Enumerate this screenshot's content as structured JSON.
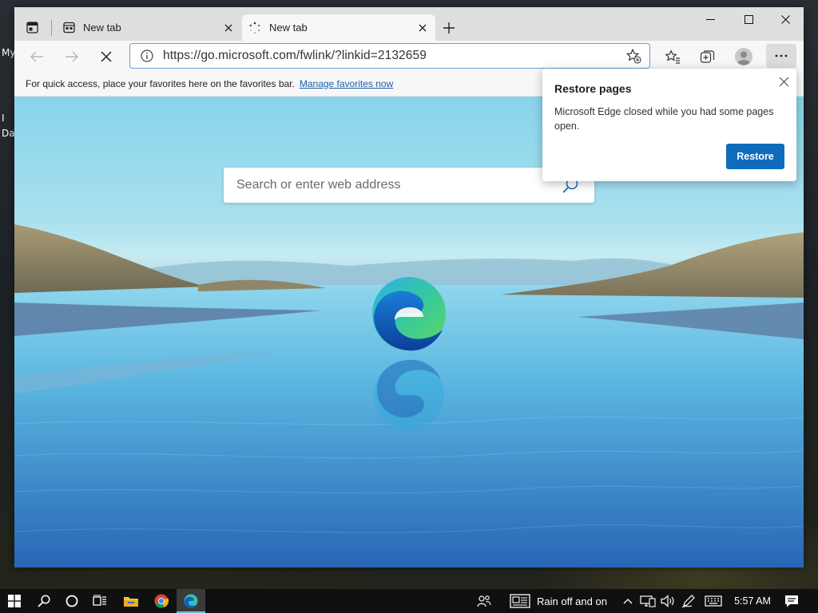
{
  "desktop": {
    "label_1": "My",
    "label_2": "I",
    "label_3": "Da"
  },
  "browser": {
    "tabs": [
      {
        "label": "New tab",
        "icon": "new-tab-page-icon",
        "active": false
      },
      {
        "label": "New tab",
        "icon": "loading-spinner-icon",
        "active": true
      }
    ],
    "address": {
      "url": "https://go.microsoft.com/fwlink/?linkid=2132659"
    },
    "favorites_bar": {
      "message": "For quick access, place your favorites here on the favorites bar.",
      "link": "Manage favorites now"
    },
    "new_tab_page": {
      "search_placeholder": "Search or enter web address"
    },
    "restore_popup": {
      "title": "Restore pages",
      "message": "Microsoft Edge closed while you had some pages open.",
      "button": "Restore"
    },
    "colors": {
      "accent": "#0f6cbd",
      "link": "#1a5fa8",
      "address_border": "#6e9dd6"
    }
  },
  "taskbar": {
    "weather": "Rain off and on",
    "time": "5:57 AM",
    "pinned": [
      "start-icon",
      "search-icon",
      "cortana-icon",
      "task-view-icon",
      "file-explorer-icon",
      "chrome-icon",
      "edge-icon"
    ]
  }
}
